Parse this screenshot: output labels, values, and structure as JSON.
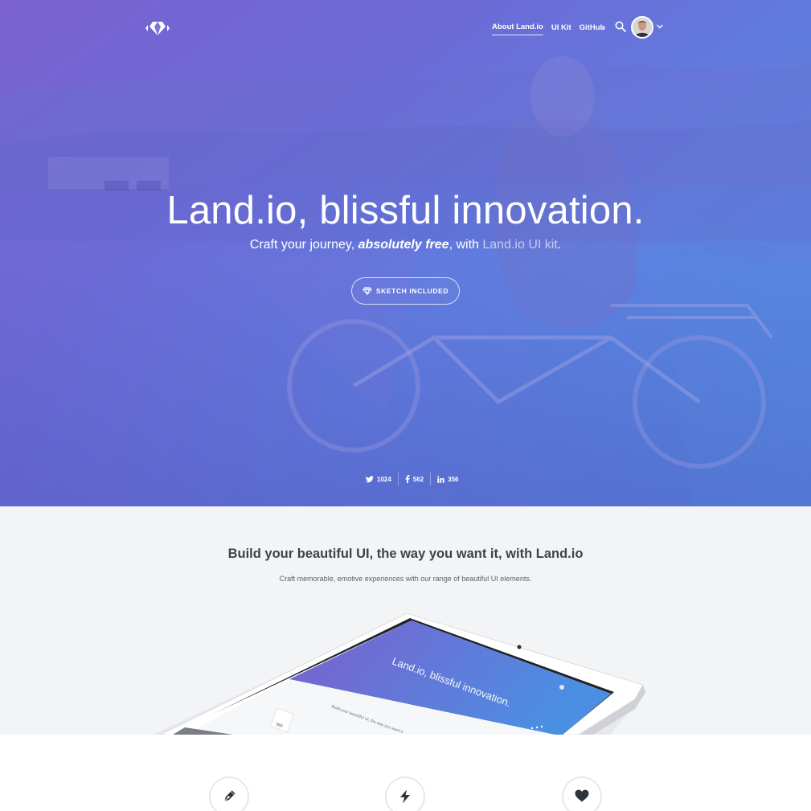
{
  "nav": {
    "logo": "landio-logo-icon",
    "links": [
      {
        "label": "About Land.io",
        "active": true
      },
      {
        "label": "UI Kit",
        "active": false
      },
      {
        "label": "GitHub",
        "active": false
      }
    ],
    "search_icon": "search-icon",
    "avatar": "user-avatar",
    "caret_icon": "chevron-down-icon"
  },
  "hero": {
    "title": "Land.io, blissful innovation.",
    "subtitle_pre": "Craft your journey, ",
    "subtitle_em": "absolutely free",
    "subtitle_mid": ", with ",
    "subtitle_faded": "Land.io UI kit",
    "subtitle_end": ".",
    "cta_label": "SKETCH INCLUDED",
    "cta_icon": "diamond-icon",
    "social": {
      "twitter_count": "1024",
      "facebook_count": "562",
      "linkedin_count": "356"
    }
  },
  "intro": {
    "title": "Build your beautiful UI, the way you want it, with Land.io",
    "subtitle": "Craft memorable, emotive experiences with our range of beautiful UI elements."
  },
  "features": {
    "icons": [
      "pen-nib-icon",
      "lightning-icon",
      "heart-icon"
    ]
  },
  "colors": {
    "hero_gradient_start": "#7a62cf",
    "hero_gradient_end": "#4b91e2",
    "intro_background": "#f3f4f6",
    "heading_text": "#3d434c",
    "feature_icon": "#2e343c"
  }
}
